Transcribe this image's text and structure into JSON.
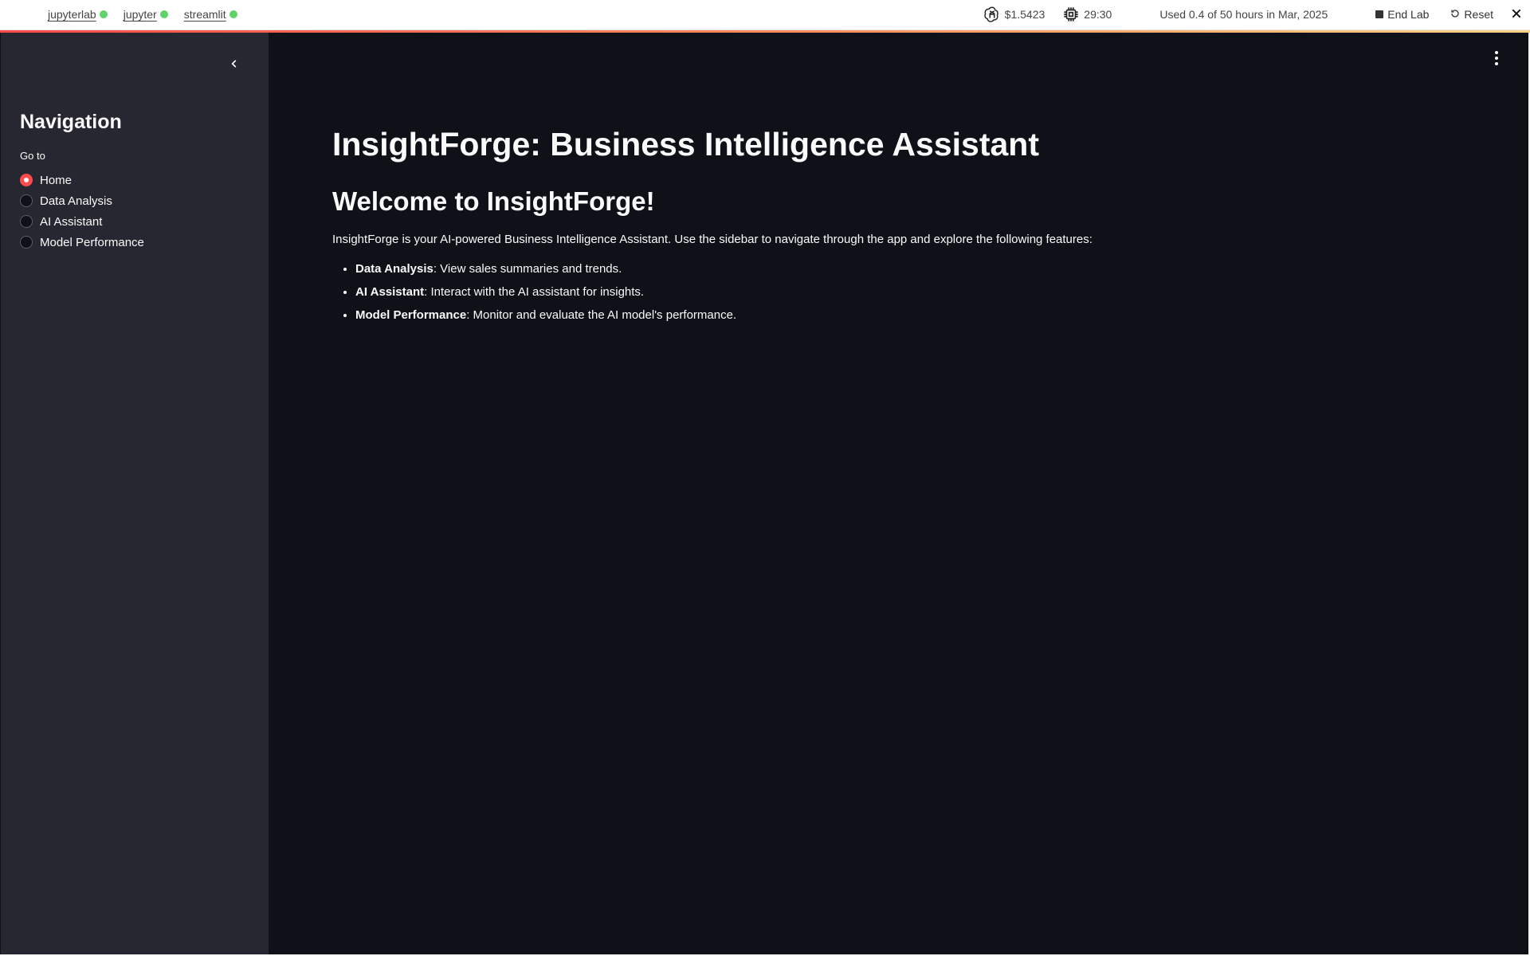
{
  "topbar": {
    "tabs": [
      {
        "label": "jupyterlab"
      },
      {
        "label": "jupyter"
      },
      {
        "label": "streamlit"
      }
    ],
    "cost": "$1.5423",
    "timer": "29:30",
    "usage": "Used 0.4 of 50 hours in Mar, 2025",
    "end_lab": "End Lab",
    "reset": "Reset",
    "icons": {
      "cost": "openai-logo-icon",
      "timer": "cpu-chip-icon",
      "close": "close-icon"
    },
    "status_color": "#5fd36a"
  },
  "sidebar": {
    "title": "Navigation",
    "group_label": "Go to",
    "options": [
      {
        "label": "Home",
        "checked": true
      },
      {
        "label": "Data Analysis",
        "checked": false
      },
      {
        "label": "AI Assistant",
        "checked": false
      },
      {
        "label": "Model Performance",
        "checked": false
      }
    ],
    "accent": "#ff4b4b"
  },
  "main": {
    "title": "InsightForge: Business Intelligence Assistant",
    "welcome": "Welcome to InsightForge!",
    "intro": "InsightForge is your AI-powered Business Intelligence Assistant. Use the sidebar to navigate through the app and explore the following features:",
    "features": [
      {
        "name": "Data Analysis",
        "desc": ": View sales summaries and trends."
      },
      {
        "name": "AI Assistant",
        "desc": ": Interact with the AI assistant for insights."
      },
      {
        "name": "Model Performance",
        "desc": ": Monitor and evaluate the AI model's performance."
      }
    ]
  }
}
